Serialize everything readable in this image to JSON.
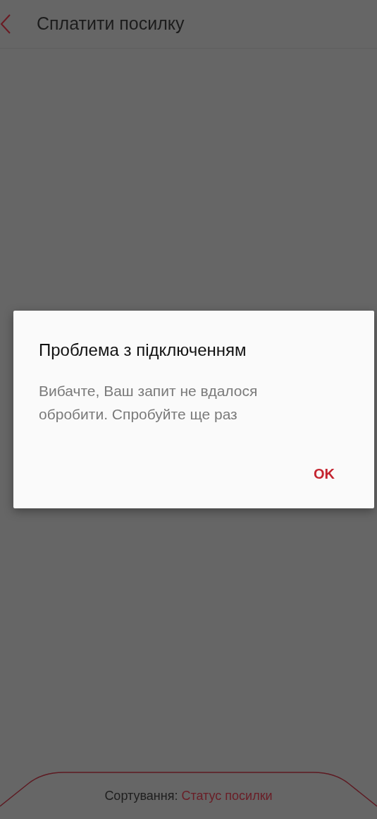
{
  "header": {
    "title": "Сплатити посилку"
  },
  "bottom_bar": {
    "label": "Сортування:",
    "value": "Статус посилки"
  },
  "dialog": {
    "title": "Проблема з підключенням",
    "message": "Вибачте, Ваш запит не вдалося обробити. Спробуйте ще раз",
    "buttons": [
      "OK"
    ]
  }
}
